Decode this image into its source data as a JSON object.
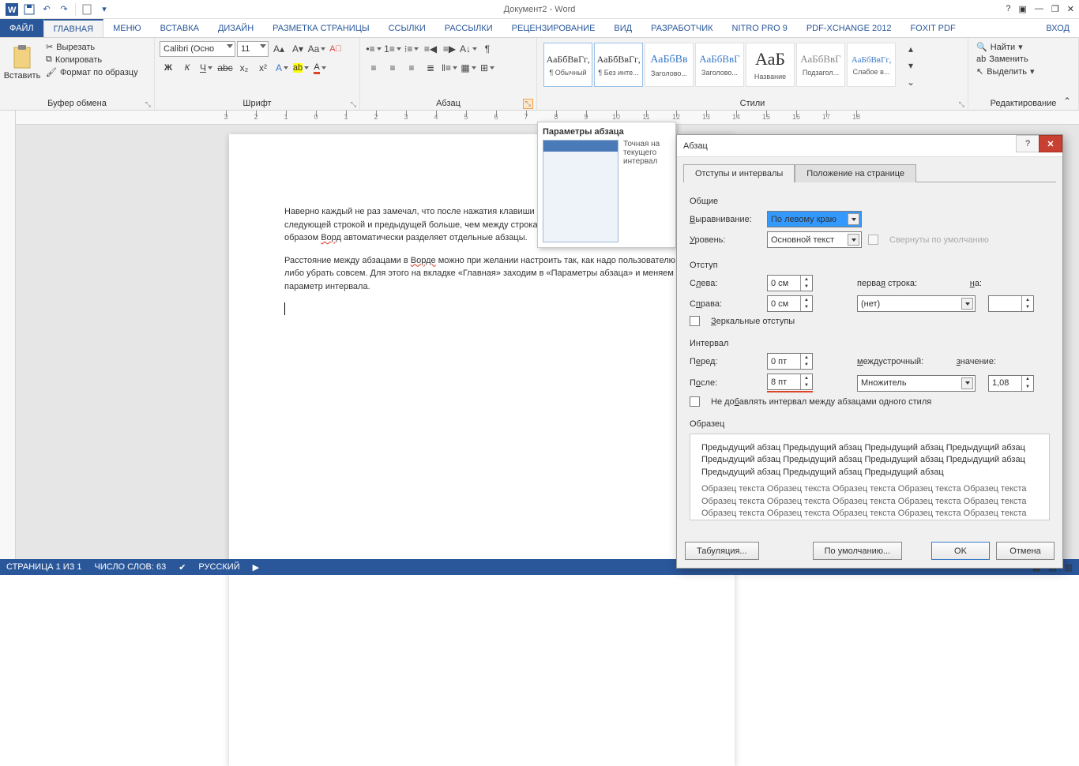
{
  "title": "Документ2 - Word",
  "qat_tips": [
    "Сохранить",
    "Отменить",
    "Повторить",
    "Новый"
  ],
  "tabs": {
    "file": "ФАЙЛ",
    "home": "ГЛАВНАЯ",
    "menu": "Меню",
    "insert": "ВСТАВКА",
    "design": "ДИЗАЙН",
    "layout": "РАЗМЕТКА СТРАНИЦЫ",
    "refs": "ССЫЛКИ",
    "mail": "РАССЫЛКИ",
    "review": "РЕЦЕНЗИРОВАНИЕ",
    "view": "ВИД",
    "developer": "РАЗРАБОТЧИК",
    "nitro": "NITRO PRO 9",
    "pdfx": "PDF-XCHANGE 2012",
    "foxit": "Foxit PDF",
    "signin": "Вход"
  },
  "clipboard": {
    "paste": "Вставить",
    "cut": "Вырезать",
    "copy": "Копировать",
    "format_painter": "Формат по образцу",
    "group": "Буфер обмена"
  },
  "font": {
    "name": "Calibri (Осно",
    "size": "11",
    "group": "Шрифт"
  },
  "paragraph": {
    "group": "Абзац"
  },
  "styles": {
    "group": "Стили",
    "items": [
      {
        "prev": "АаБбВвГг,",
        "name": "¶ Обычный"
      },
      {
        "prev": "АаБбВвГг,",
        "name": "¶ Без инте..."
      },
      {
        "prev": "АаБбВв",
        "name": "Заголово..."
      },
      {
        "prev": "АаБбВвГ",
        "name": "Заголово..."
      },
      {
        "prev": "АаБ",
        "name": "Название"
      },
      {
        "prev": "АаБбВвГ",
        "name": "Подзагол..."
      },
      {
        "prev": "АаБбВвГг,",
        "name": "Слабое в..."
      }
    ]
  },
  "editing": {
    "find": "Найти",
    "replace": "Заменить",
    "select": "Выделить",
    "group": "Редактирование"
  },
  "tooltip": {
    "title": "Параметры абзаца",
    "text": "Точная на\nтекущего\nинтервал"
  },
  "doc": {
    "p1": "Наверно каждый не раз замечал, что после нажатия клавиши «Enter» расстояние между следующей строкой и предыдущей больше, чем между строками сплошного текста. Таким образом ",
    "p1w": "Ворд",
    "p1b": " автоматически разделяет отдельные абзацы.",
    "p2a": "Расстояние между абзацами в ",
    "p2w": "Ворде",
    "p2b": " можно при желании настроить так, как надо пользователю, либо убрать совсем. Для этого на вкладке «Главная» заходим в «Параметры абзаца» и меняем параметр интервала."
  },
  "dialog": {
    "title": "Абзац",
    "tab1": "Отступы и интервалы",
    "tab2": "Положение на странице",
    "sec_general": "Общие",
    "alignment_label": "Выравнивание:",
    "alignment_value": "По левому краю",
    "level_label": "Уровень:",
    "level_value": "Основной текст",
    "collapsed": "Свернуты по умолчанию",
    "sec_indent": "Отступ",
    "left_label": "Слева:",
    "left_value": "0 см",
    "right_label": "Справа:",
    "right_value": "0 см",
    "firstline_label": "первая строка:",
    "firstline_value": "(нет)",
    "on_label": "на:",
    "on_value": "",
    "mirror": "Зеркальные отступы",
    "sec_spacing": "Интервал",
    "before_label": "Перед:",
    "before_value": "0 пт",
    "after_label": "После:",
    "after_value": "8 пт",
    "line_label": "междустрочный:",
    "line_value": "Множитель",
    "val_label": "значение:",
    "val_value": "1,08",
    "noadd": "Не добавлять интервал между абзацами одного стиля",
    "sec_preview": "Образец",
    "preview_grey": "Предыдущий абзац Предыдущий абзац Предыдущий абзац Предыдущий абзац Предыдущий абзац Предыдущий абзац Предыдущий абзац Предыдущий абзац Предыдущий абзац Предыдущий абзац Предыдущий абзац",
    "preview_dark": "Образец текста Образец текста Образец текста Образец текста Образец текста Образец текста Образец текста Образец текста Образец текста Образец текста Образец текста Образец текста Образец текста Образец текста Образец текста",
    "tabs_btn": "Табуляция...",
    "default_btn": "По умолчанию...",
    "ok": "OK",
    "cancel": "Отмена"
  },
  "status": {
    "page": "СТРАНИЦА 1 ИЗ 1",
    "words": "ЧИСЛО СЛОВ: 63",
    "lang": "РУССКИЙ"
  }
}
